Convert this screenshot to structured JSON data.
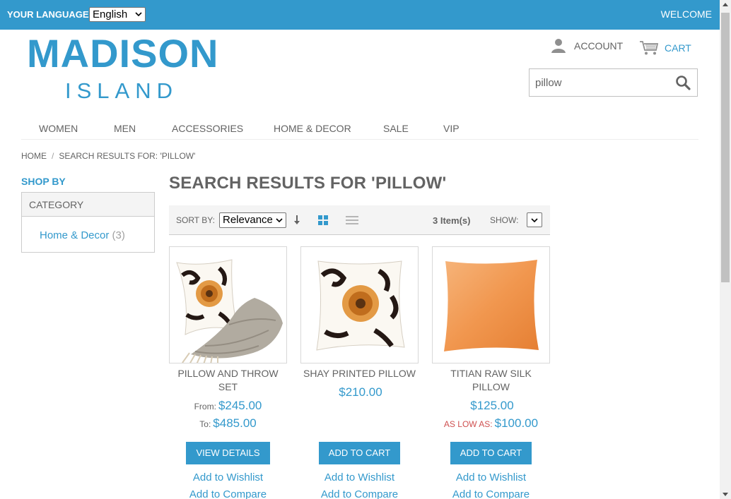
{
  "topbar": {
    "language_label": "YOUR LANGUAGE:",
    "language_value": "English",
    "welcome": "WELCOME"
  },
  "logo": {
    "main": "MADISON",
    "sub": "ISLAND"
  },
  "header": {
    "account_label": "ACCOUNT",
    "cart_label": "CART",
    "search_value": "pillow"
  },
  "nav": {
    "items": [
      "WOMEN",
      "MEN",
      "ACCESSORIES",
      "HOME & DECOR",
      "SALE",
      "VIP"
    ]
  },
  "breadcrumb": {
    "home": "HOME",
    "separator": "/",
    "current": "SEARCH RESULTS FOR: 'PILLOW'"
  },
  "sidebar": {
    "heading": "SHOP BY",
    "category_title": "CATEGORY",
    "category_item": "Home & Decor",
    "category_count": "(3)"
  },
  "page": {
    "title": "SEARCH RESULTS FOR 'PILLOW'"
  },
  "toolbar": {
    "sort_label": "SORT BY:",
    "sort_value": "Relevance",
    "item_count": "3 Item(s)",
    "show_label": "SHOW:"
  },
  "products": [
    {
      "name": "PILLOW AND THROW SET",
      "from_label": "From:",
      "from_price": "$245.00",
      "to_label": "To:",
      "to_price": "$485.00",
      "button": "VIEW DETAILS",
      "wishlist": "Add to Wishlist",
      "compare": "Add to Compare"
    },
    {
      "name": "SHAY PRINTED PILLOW",
      "price": "$210.00",
      "button": "ADD TO CART",
      "wishlist": "Add to Wishlist",
      "compare": "Add to Compare"
    },
    {
      "name": "TITIAN RAW SILK PILLOW",
      "price": "$125.00",
      "as_low_label": "AS LOW AS:",
      "as_low_price": "$100.00",
      "button": "ADD TO CART",
      "wishlist": "Add to Wishlist",
      "compare": "Add to Compare"
    }
  ],
  "colors": {
    "accent": "#3399cc",
    "text": "#636363",
    "sale_label": "#cf5050"
  }
}
